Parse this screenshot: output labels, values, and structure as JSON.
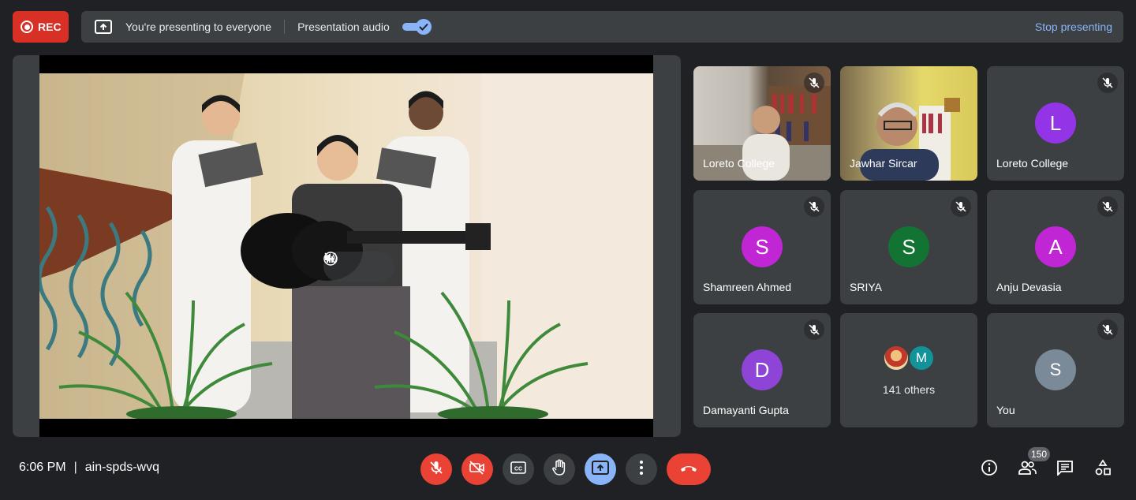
{
  "topbar": {
    "rec_label": "REC",
    "presenting_text": "You're presenting to everyone",
    "audio_label": "Presentation audio",
    "audio_enabled": true,
    "stop_label": "Stop presenting"
  },
  "participants": [
    {
      "name": "Loreto College",
      "type": "camera",
      "muted": true
    },
    {
      "name": "Jawhar Sircar",
      "type": "camera",
      "muted": false
    },
    {
      "name": "Loreto College",
      "initial": "L",
      "avatar_color": "#9334e6",
      "muted": true
    },
    {
      "name": "Shamreen Ahmed",
      "initial": "S",
      "avatar_color": "#c026d3",
      "muted": true
    },
    {
      "name": "SRIYA",
      "initial": "S",
      "avatar_color": "#137333",
      "muted": true
    },
    {
      "name": "Anju Devasia",
      "initial": "A",
      "avatar_color": "#c026d3",
      "muted": true
    },
    {
      "name": "Damayanti Gupta",
      "initial": "D",
      "avatar_color": "#8e44d6",
      "muted": true
    },
    {
      "type": "others",
      "initial": "M",
      "label": "141 others"
    },
    {
      "name": "You",
      "initial": "S",
      "avatar_color": "#7b8a99",
      "muted": true
    }
  ],
  "bottombar": {
    "time": "6:06 PM",
    "meeting_code": "ain-spds-wvq",
    "people_count": "150"
  },
  "icons": {
    "mic_off": "mic-off-icon",
    "cam_off": "videocam-off-icon",
    "captions": "closed-caption-icon",
    "raise_hand": "hand-icon",
    "present": "present-screen-icon",
    "more": "more-vert-icon",
    "hangup": "call-end-icon",
    "info": "info-icon",
    "people": "people-icon",
    "chat": "chat-icon",
    "activities": "activities-icon"
  },
  "colors": {
    "background": "#202124",
    "surface": "#3c4043",
    "accent": "#8ab4f8",
    "danger": "#ea4335"
  }
}
